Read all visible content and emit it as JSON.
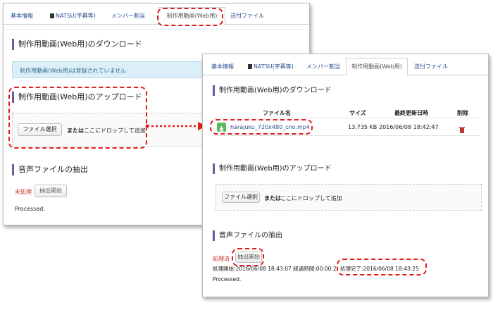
{
  "back": {
    "tabs": [
      {
        "label": "基本情報",
        "active": false,
        "icon": null
      },
      {
        "label": "NATSU(字幕等)",
        "active": false,
        "icon": "document-icon"
      },
      {
        "label": "メンバー割当",
        "active": false,
        "icon": null
      },
      {
        "label": "制作用動画(Web用)",
        "active": true,
        "icon": null
      },
      {
        "label": "送付ファイル",
        "active": false,
        "icon": null
      }
    ],
    "download_heading": "制作用動画(Web用)のダウンロード",
    "not_registered_msg": "制作用動画(Web用)は登録されていません",
    "upload_heading": "制作用動画(Web用)のアップロード",
    "file_select_label": "ファイル選択",
    "drop_or": "または",
    "drop_text": "ここにドロップして追加",
    "audio_heading": "音声ファイルの抽出",
    "status_label": "未処理",
    "extract_button": "抽出開始",
    "processed": "Processed."
  },
  "front": {
    "tabs": [
      {
        "label": "基本情報",
        "active": false,
        "icon": null
      },
      {
        "label": "NATSU(字幕等)",
        "active": false,
        "icon": "document-icon"
      },
      {
        "label": "メンバー割当",
        "active": false,
        "icon": null
      },
      {
        "label": "制作用動画(Web用)",
        "active": true,
        "icon": null
      },
      {
        "label": "送付ファイル",
        "active": false,
        "icon": null
      }
    ],
    "download_heading": "制作用動画(Web用)のダウンロード",
    "table": {
      "headers": {
        "filename": "ファイル名",
        "size": "サイズ",
        "modified": "最終更新日時",
        "delete": "削除"
      },
      "rows": [
        {
          "filename": "harajuku_720x480_cno.mp4",
          "size": "13,735 KB",
          "modified": "2016/06/08 18:42:47",
          "icon": "download-icon",
          "delete_icon": "trash-icon"
        }
      ]
    },
    "upload_heading": "制作用動画(Web用)のアップロード",
    "file_select_label": "ファイル選択",
    "drop_or": "または",
    "drop_text": "ここにドロップして追加",
    "audio_heading": "音声ファイルの抽出",
    "status_label": "処理済",
    "extract_button": "抽出開始",
    "start_info": "処理開始:2016/06/08 18:43:07 経過時間:00:00:2",
    "complete_info": "処理完了:2016/06/08 18:43:25",
    "processed": "Processed."
  },
  "colors": {
    "accent_bar": "#6d5a9c",
    "annotation": "#e31b1b",
    "link": "#2a4f8f",
    "info_bg": "#dceef8",
    "download_icon_bg": "#5cb85c",
    "status_red": "#c9302c"
  }
}
